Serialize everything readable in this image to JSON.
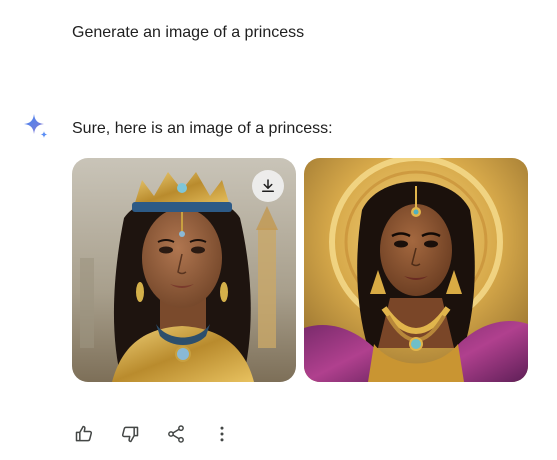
{
  "conversation": {
    "user_prompt": "Generate an image of a princess",
    "response_text": "Sure, here is an image of a princess:",
    "images": [
      {
        "name": "princess-image-1",
        "has_download_button": true
      },
      {
        "name": "princess-image-2",
        "has_download_button": false
      }
    ]
  },
  "icons": {
    "assistant": "gemini-sparkle-icon",
    "download": "download-icon",
    "like": "thumbs-up-icon",
    "dislike": "thumbs-down-icon",
    "share": "share-icon",
    "more": "more-vertical-icon"
  },
  "colors": {
    "text": "#1f1f1f",
    "icon": "#444746",
    "sparkle_blue": "#4285f4",
    "sparkle_purple": "#9b72cb"
  }
}
